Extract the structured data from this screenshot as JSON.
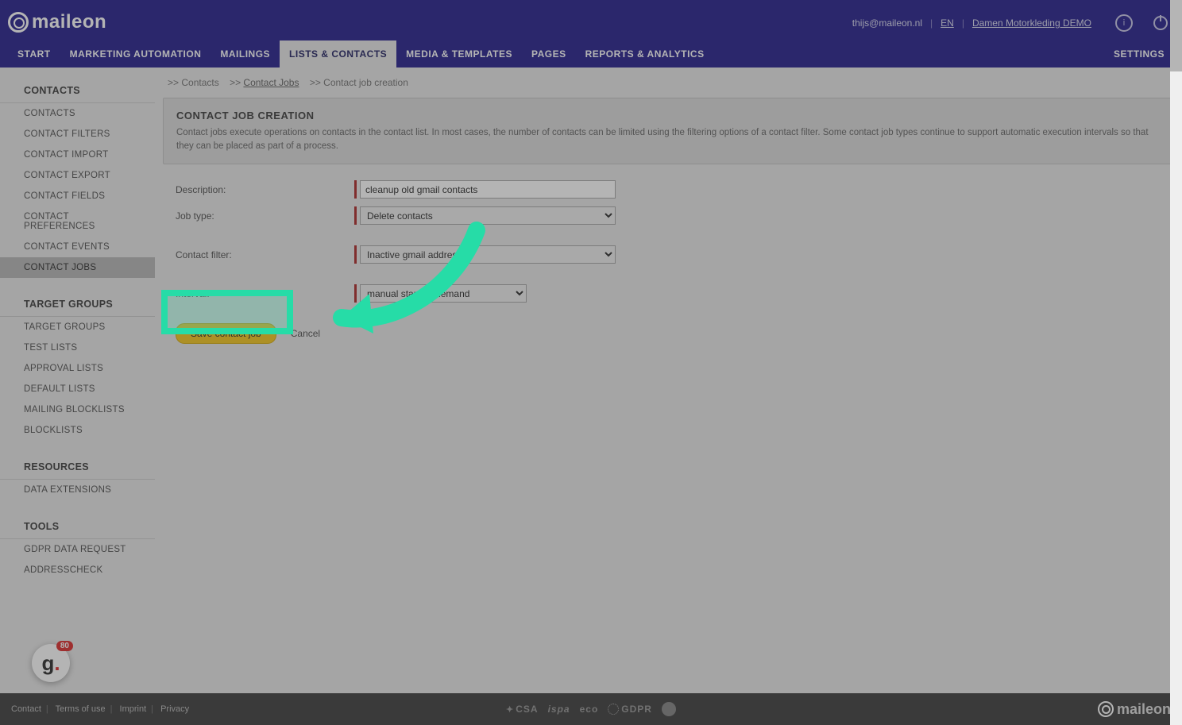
{
  "brand": "maileon",
  "header": {
    "user_email": "thijs@maileon.nl",
    "lang": "EN",
    "account_link": "Damen Motorkleding DEMO",
    "info_label": "i"
  },
  "topnav": {
    "items": [
      {
        "label": "START"
      },
      {
        "label": "MARKETING AUTOMATION"
      },
      {
        "label": "MAILINGS"
      },
      {
        "label": "LISTS & CONTACTS",
        "active": true
      },
      {
        "label": "MEDIA & TEMPLATES"
      },
      {
        "label": "PAGES"
      },
      {
        "label": "REPORTS & ANALYTICS"
      }
    ],
    "settings": "SETTINGS"
  },
  "sidebar": {
    "sections": [
      {
        "title": "CONTACTS",
        "items": [
          {
            "label": "CONTACTS"
          },
          {
            "label": "CONTACT FILTERS"
          },
          {
            "label": "CONTACT IMPORT"
          },
          {
            "label": "CONTACT EXPORT"
          },
          {
            "label": "CONTACT FIELDS"
          },
          {
            "label": "CONTACT PREFERENCES"
          },
          {
            "label": "CONTACT EVENTS"
          },
          {
            "label": "CONTACT JOBS",
            "active": true
          }
        ]
      },
      {
        "title": "TARGET GROUPS",
        "items": [
          {
            "label": "TARGET GROUPS"
          },
          {
            "label": "TEST LISTS"
          },
          {
            "label": "APPROVAL LISTS"
          },
          {
            "label": "DEFAULT LISTS"
          },
          {
            "label": "MAILING BLOCKLISTS"
          },
          {
            "label": "BLOCKLISTS"
          }
        ]
      },
      {
        "title": "RESOURCES",
        "items": [
          {
            "label": "DATA EXTENSIONS"
          }
        ]
      },
      {
        "title": "TOOLS",
        "items": [
          {
            "label": "GDPR DATA REQUEST"
          },
          {
            "label": "ADDRESSCHECK"
          }
        ]
      }
    ]
  },
  "breadcrumb": {
    "sep": ">>",
    "items": [
      {
        "label": "Contacts",
        "link": false
      },
      {
        "label": "Contact Jobs",
        "link": true
      },
      {
        "label": "Contact job creation",
        "link": false
      }
    ]
  },
  "panel": {
    "title": "CONTACT JOB CREATION",
    "desc": "Contact jobs execute operations on contacts in the contact list. In most cases, the number of contacts can be limited using the filtering options of a contact filter. Some contact job types continue to support automatic execution intervals so that they can be placed as part of a process."
  },
  "form": {
    "description_label": "Description:",
    "description_value": "cleanup old gmail contacts",
    "jobtype_label": "Job type:",
    "jobtype_value": "Delete contacts",
    "filter_label": "Contact filter:",
    "filter_value": "Inactive gmail addresses",
    "interval_label": "Interval:",
    "interval_value": "manual start on demand",
    "save_label": "Save contact job",
    "cancel_label": "Cancel"
  },
  "footer": {
    "links": [
      "Contact",
      "Terms of use",
      "Imprint",
      "Privacy"
    ],
    "badges": [
      "CSA",
      "ispa",
      "eco",
      "GDPR"
    ]
  },
  "float_badge": {
    "glyph": "g",
    "dot": ".",
    "count": "80"
  },
  "annotation": {
    "arrow_color": "#26dca7"
  }
}
